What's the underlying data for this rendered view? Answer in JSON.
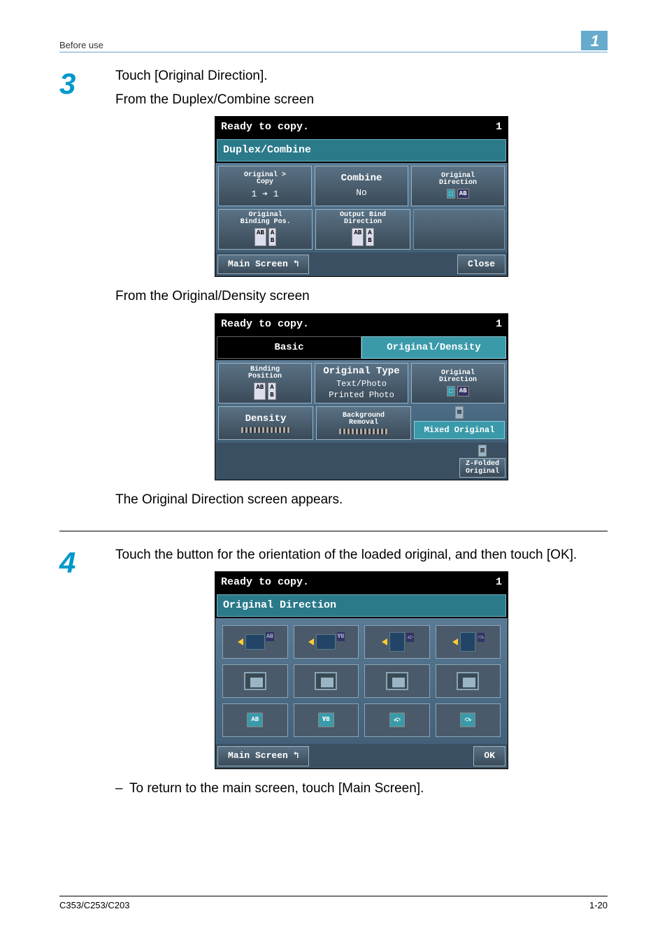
{
  "header": {
    "left": "Before use",
    "right": "1"
  },
  "steps": {
    "three": {
      "num": "3",
      "line1": "Touch [Original Direction].",
      "line2": "From the Duplex/Combine screen",
      "line3": "From the Original/Density screen",
      "line4": "The Original Direction screen appears."
    },
    "four": {
      "num": "4",
      "line1": "Touch the button for the orientation of the loaded original, and then touch [OK].",
      "sub1": "To return to the main screen, touch [Main Screen]."
    }
  },
  "ss1": {
    "status": "Ready to copy.",
    "count": "1",
    "title": "Duplex/Combine",
    "b1_label": "Original >\nCopy",
    "b1_val": "1 ➔ 1",
    "b2_label": "Combine",
    "b2_val": "No",
    "b3_label": "Original\nDirection",
    "b4_label": "Original\nBinding Pos.",
    "b5_label": "Output Bind\nDirection",
    "main": "Main Screen",
    "close": "Close"
  },
  "ss2": {
    "status": "Ready to copy.",
    "count": "1",
    "tab1": "Basic",
    "tab2": "Original/Density",
    "b1_label": "Binding\nPosition",
    "b2_label": "Original Type",
    "b2_val1": "Text/Photo",
    "b2_val2": "Printed Photo",
    "b3_label": "Original\nDirection",
    "b4_label": "Density",
    "b5_label": "Background\nRemoval",
    "b6_label": "Mixed Original",
    "b7_label": "Z-Folded\nOriginal"
  },
  "ss3": {
    "status": "Ready to copy.",
    "count": "1",
    "title": "Original Direction",
    "main": "Main Screen",
    "ok": "OK"
  },
  "footer": {
    "left": "C353/C253/C203",
    "right": "1-20"
  }
}
